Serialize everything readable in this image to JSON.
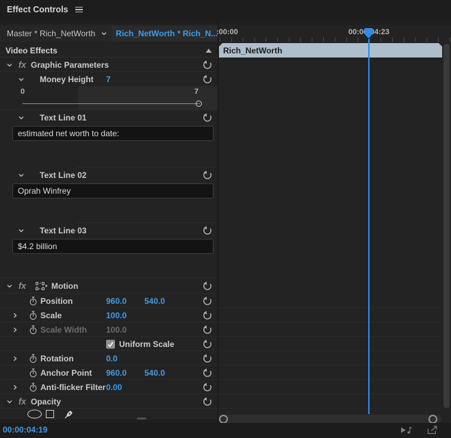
{
  "panel": {
    "title": "Effect Controls"
  },
  "clip_selector": {
    "master": "Master * Rich_NetWorth",
    "clip": "Rich_NetWorth * Rich_N..."
  },
  "ruler": {
    "start": ":00:00",
    "playhead_time": "00:00:04:23"
  },
  "timeline": {
    "clip_name": "Rich_NetWorth"
  },
  "video_effects": {
    "header": "Video Effects"
  },
  "graphic_parameters": {
    "fx": "fx",
    "name": "Graphic Parameters",
    "money_height": {
      "label": "Money Height",
      "value": "7",
      "min": "0",
      "max": "7"
    },
    "text_line_01": {
      "label": "Text Line 01",
      "value": "estimated net worth to date:"
    },
    "text_line_02": {
      "label": "Text Line 02",
      "value": "Oprah Winfrey"
    },
    "text_line_03": {
      "label": "Text Line 03",
      "value": "$4.2 billion"
    }
  },
  "motion": {
    "fx": "fx",
    "name": "Motion",
    "position": {
      "label": "Position",
      "x": "960.0",
      "y": "540.0"
    },
    "scale": {
      "label": "Scale",
      "value": "100.0"
    },
    "scale_width": {
      "label": "Scale Width",
      "value": "100.0"
    },
    "uniform_scale": {
      "label": "Uniform Scale",
      "checked": "true"
    },
    "rotation": {
      "label": "Rotation",
      "value": "0.0"
    },
    "anchor_point": {
      "label": "Anchor Point",
      "x": "960.0",
      "y": "540.0"
    },
    "anti_flicker": {
      "label": "Anti-flicker Filter",
      "value": "0.00"
    }
  },
  "opacity": {
    "fx": "fx",
    "name": "Opacity"
  },
  "status_bar": {
    "timecode": "00:00:04:19"
  },
  "icons": {
    "panel_menu": "hamburger",
    "tab_next": "play-arrow-right",
    "reset": "counterclockwise-arrow",
    "keyframe_toggle": "stopwatch",
    "mask_tools": [
      "ellipse",
      "rectangle",
      "pen"
    ],
    "bottom_right": [
      "play-audio",
      "export-frame"
    ]
  },
  "colors": {
    "accent_blue": "#3f9bea",
    "playhead_blue": "#2d8ceb",
    "clip_bar": "#aebecd",
    "panel_bg": "#232323",
    "bar_bg": "#1d1d1d"
  }
}
